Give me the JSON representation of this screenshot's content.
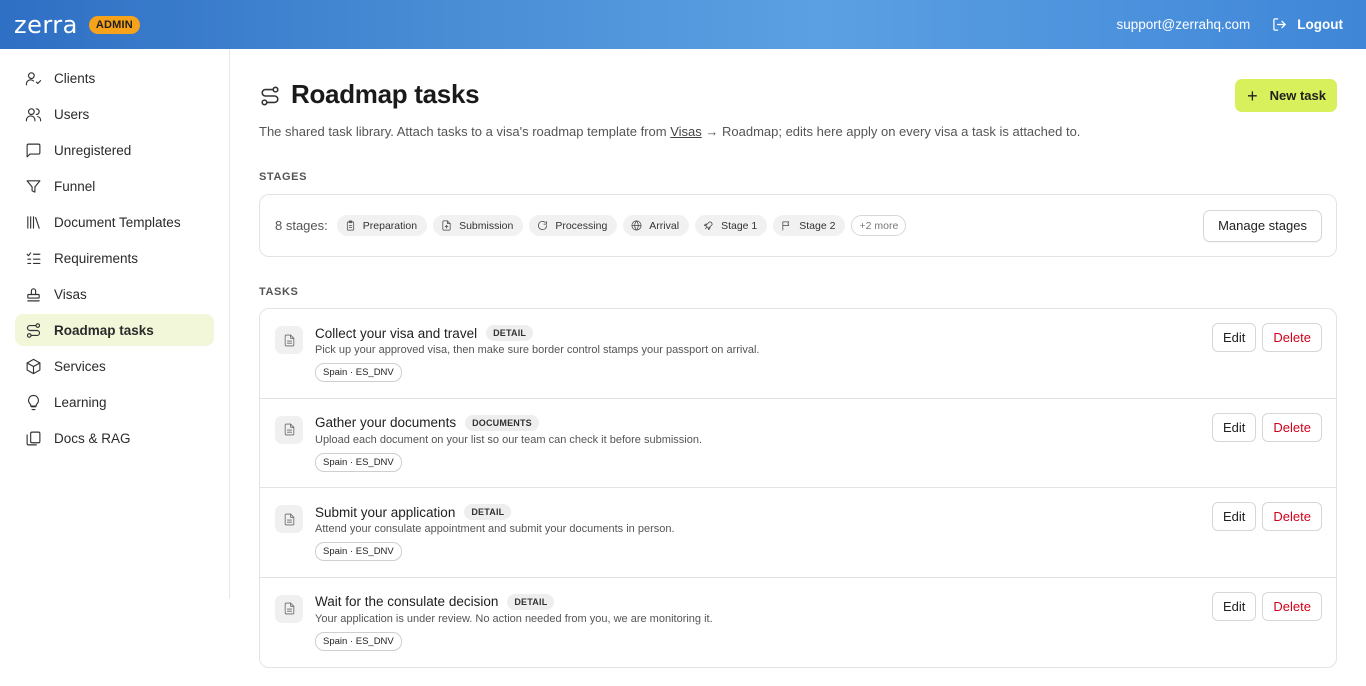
{
  "header": {
    "logo": "zerra",
    "badge": "ADMIN",
    "email": "support@zerrahq.com",
    "logout_label": "Logout"
  },
  "sidebar": {
    "items": [
      {
        "label": "Clients",
        "icon": "user-check-icon"
      },
      {
        "label": "Users",
        "icon": "users-icon"
      },
      {
        "label": "Unregistered",
        "icon": "message-square-icon"
      },
      {
        "label": "Funnel",
        "icon": "funnel-icon"
      },
      {
        "label": "Document Templates",
        "icon": "library-icon"
      },
      {
        "label": "Requirements",
        "icon": "checklist-icon"
      },
      {
        "label": "Visas",
        "icon": "stamp-icon"
      },
      {
        "label": "Roadmap tasks",
        "icon": "route-icon",
        "active": true
      },
      {
        "label": "Services",
        "icon": "package-icon"
      },
      {
        "label": "Learning",
        "icon": "lightbulb-icon"
      },
      {
        "label": "Docs & RAG",
        "icon": "files-icon"
      }
    ]
  },
  "main": {
    "title": "Roadmap tasks",
    "new_task_label": "New task",
    "subtitle_before": "The shared task library. Attach tasks to a visa's roadmap template from ",
    "subtitle_link": "Visas",
    "subtitle_after": " → Roadmap; edits here apply on every visa a task is attached to.",
    "stages_label": "STAGES",
    "stages_count": "8 stages:",
    "stages": [
      {
        "label": "Preparation",
        "icon": "clipboard-icon"
      },
      {
        "label": "Submission",
        "icon": "file-up-icon"
      },
      {
        "label": "Processing",
        "icon": "refresh-icon"
      },
      {
        "label": "Arrival",
        "icon": "globe-icon"
      },
      {
        "label": "Stage 1",
        "icon": "rocket-icon"
      },
      {
        "label": "Stage 2",
        "icon": "flag-icon"
      }
    ],
    "stages_more": "+2 more",
    "manage_stages_label": "Manage stages",
    "tasks_label": "TASKS",
    "edit_label": "Edit",
    "delete_label": "Delete",
    "tasks": [
      {
        "title": "Collect your visa and travel",
        "tag": "DETAIL",
        "desc": "Pick up your approved visa, then make sure border control stamps your passport on arrival.",
        "visa": "Spain · ES_DNV"
      },
      {
        "title": "Gather your documents",
        "tag": "DOCUMENTS",
        "desc": "Upload each document on your list so our team can check it before submission.",
        "visa": "Spain · ES_DNV"
      },
      {
        "title": "Submit your application",
        "tag": "DETAIL",
        "desc": "Attend your consulate appointment and submit your documents in person.",
        "visa": "Spain · ES_DNV"
      },
      {
        "title": "Wait for the consulate decision",
        "tag": "DETAIL",
        "desc": "Your application is under review. No action needed from you, we are monitoring it.",
        "visa": "Spain · ES_DNV"
      }
    ]
  },
  "colors": {
    "accent": "#d8f05b",
    "admin_badge": "#f7a21b",
    "delete_text": "#d0021b",
    "active_nav_bg": "#f1f7d8"
  }
}
